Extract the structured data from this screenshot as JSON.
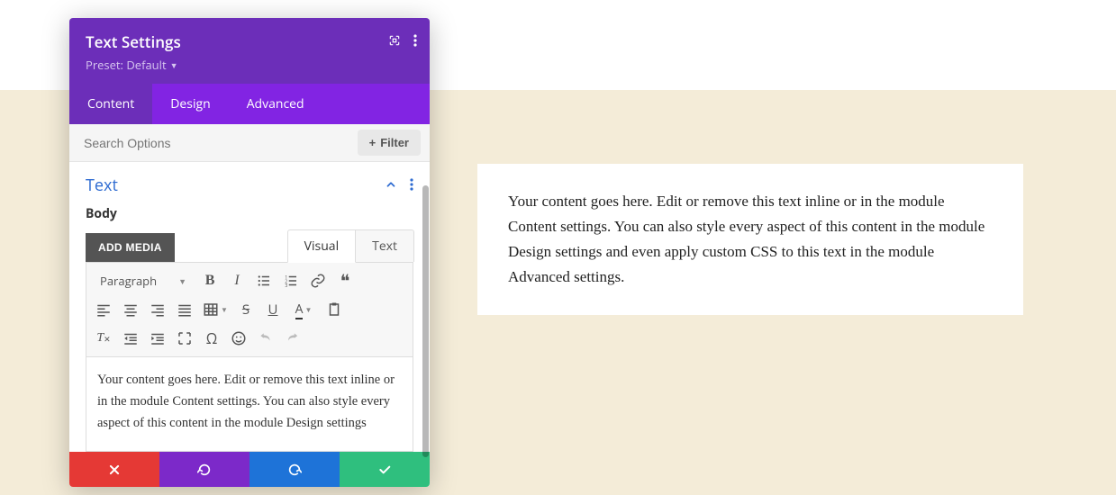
{
  "header": {
    "title": "Text Settings",
    "preset_label": "Preset: Default"
  },
  "tabs": {
    "content": "Content",
    "design": "Design",
    "advanced": "Advanced"
  },
  "search": {
    "placeholder": "Search Options",
    "filter_label": "Filter"
  },
  "section": {
    "title": "Text",
    "body_label": "Body",
    "add_media": "ADD MEDIA"
  },
  "editor_tabs": {
    "visual": "Visual",
    "text": "Text"
  },
  "toolbar": {
    "format_select": "Paragraph",
    "font_label": "A"
  },
  "editor_content": "Your content goes here. Edit or remove this text inline or in the module Content settings. You can also style every aspect of this content in the module Design settings",
  "preview_text": "Your content goes here. Edit or remove this text inline or in the module Content settings. You can also style every aspect of this content in the module Design settings and even apply custom CSS to this text in the module Advanced settings."
}
